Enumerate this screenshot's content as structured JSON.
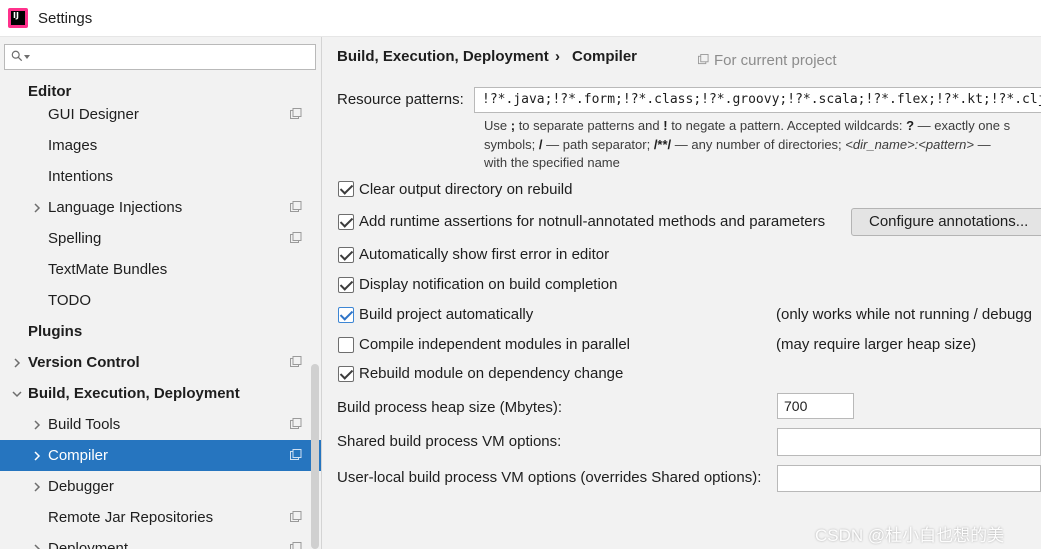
{
  "window": {
    "title": "Settings"
  },
  "search": {
    "value": "",
    "placeholder": ""
  },
  "sidebar": {
    "items": [
      {
        "label": "Editor"
      },
      {
        "label": "GUI Designer"
      },
      {
        "label": "Images"
      },
      {
        "label": "Intentions"
      },
      {
        "label": "Language Injections"
      },
      {
        "label": "Spelling"
      },
      {
        "label": "TextMate Bundles"
      },
      {
        "label": "TODO"
      },
      {
        "label": "Plugins"
      },
      {
        "label": "Version Control"
      },
      {
        "label": "Build, Execution, Deployment"
      },
      {
        "label": "Build Tools"
      },
      {
        "label": "Compiler",
        "selected": true
      },
      {
        "label": "Debugger"
      },
      {
        "label": "Remote Jar Repositories"
      },
      {
        "label": "Deployment"
      }
    ]
  },
  "header": {
    "crumb_parent": "Build, Execution, Deployment",
    "separator": "›",
    "crumb_current": "Compiler",
    "for_current_project": "For current project"
  },
  "compiler": {
    "resource_patterns_label": "Resource patterns:",
    "resource_patterns_value": "!?*.java;!?*.form;!?*.class;!?*.groovy;!?*.scala;!?*.flex;!?*.kt;!?*.clj;!?*.aj",
    "hint": {
      "line1_a": "Use ",
      "line1_semicolon": ";",
      "line1_b": " to separate patterns and ",
      "line1_bang": "!",
      "line1_c": " to negate a pattern. Accepted wildcards: ",
      "line1_q": "?",
      "line1_d": " — exactly one s",
      "line2_a": "symbols; ",
      "line2_slash": "/",
      "line2_b": " — path separator; ",
      "line2_any": "/**/",
      "line2_c": " — any number of directories; ",
      "line2_d": "<dir_name>:<pattern>",
      "line2_e": " —",
      "line3": "with the specified name"
    },
    "options": [
      {
        "label": "Clear output directory on rebuild",
        "checked": true
      },
      {
        "label": "Add runtime assertions for notnull-annotated methods and parameters",
        "checked": true
      },
      {
        "label": "Automatically show first error in editor",
        "checked": true
      },
      {
        "label": "Display notification on build completion",
        "checked": true
      },
      {
        "label": "Build project automatically",
        "checked": true,
        "note": "(only works while not running / debugg"
      },
      {
        "label": "Compile independent modules in parallel",
        "checked": false,
        "note": "(may require larger heap size)"
      },
      {
        "label": "Rebuild module on dependency change",
        "checked": true
      }
    ],
    "configure_annotations_label": "Configure annotations...",
    "heap_size_label": "Build process heap size (Mbytes):",
    "heap_size_value": "700",
    "shared_vm_label": "Shared build process VM options:",
    "shared_vm_value": "",
    "user_vm_label": "User-local build process VM options (overrides Shared options):",
    "user_vm_value": ""
  },
  "watermark": "CSDN @杜小白也想的美",
  "colors": {
    "selection": "#2675bf",
    "checkbox_accent": "#2f74c8",
    "background": "#f2f2f2"
  },
  "icons": [
    "intellij-app-icon",
    "search-icon",
    "chevron-right-icon",
    "chevron-down-icon",
    "project-scope-icon"
  ]
}
